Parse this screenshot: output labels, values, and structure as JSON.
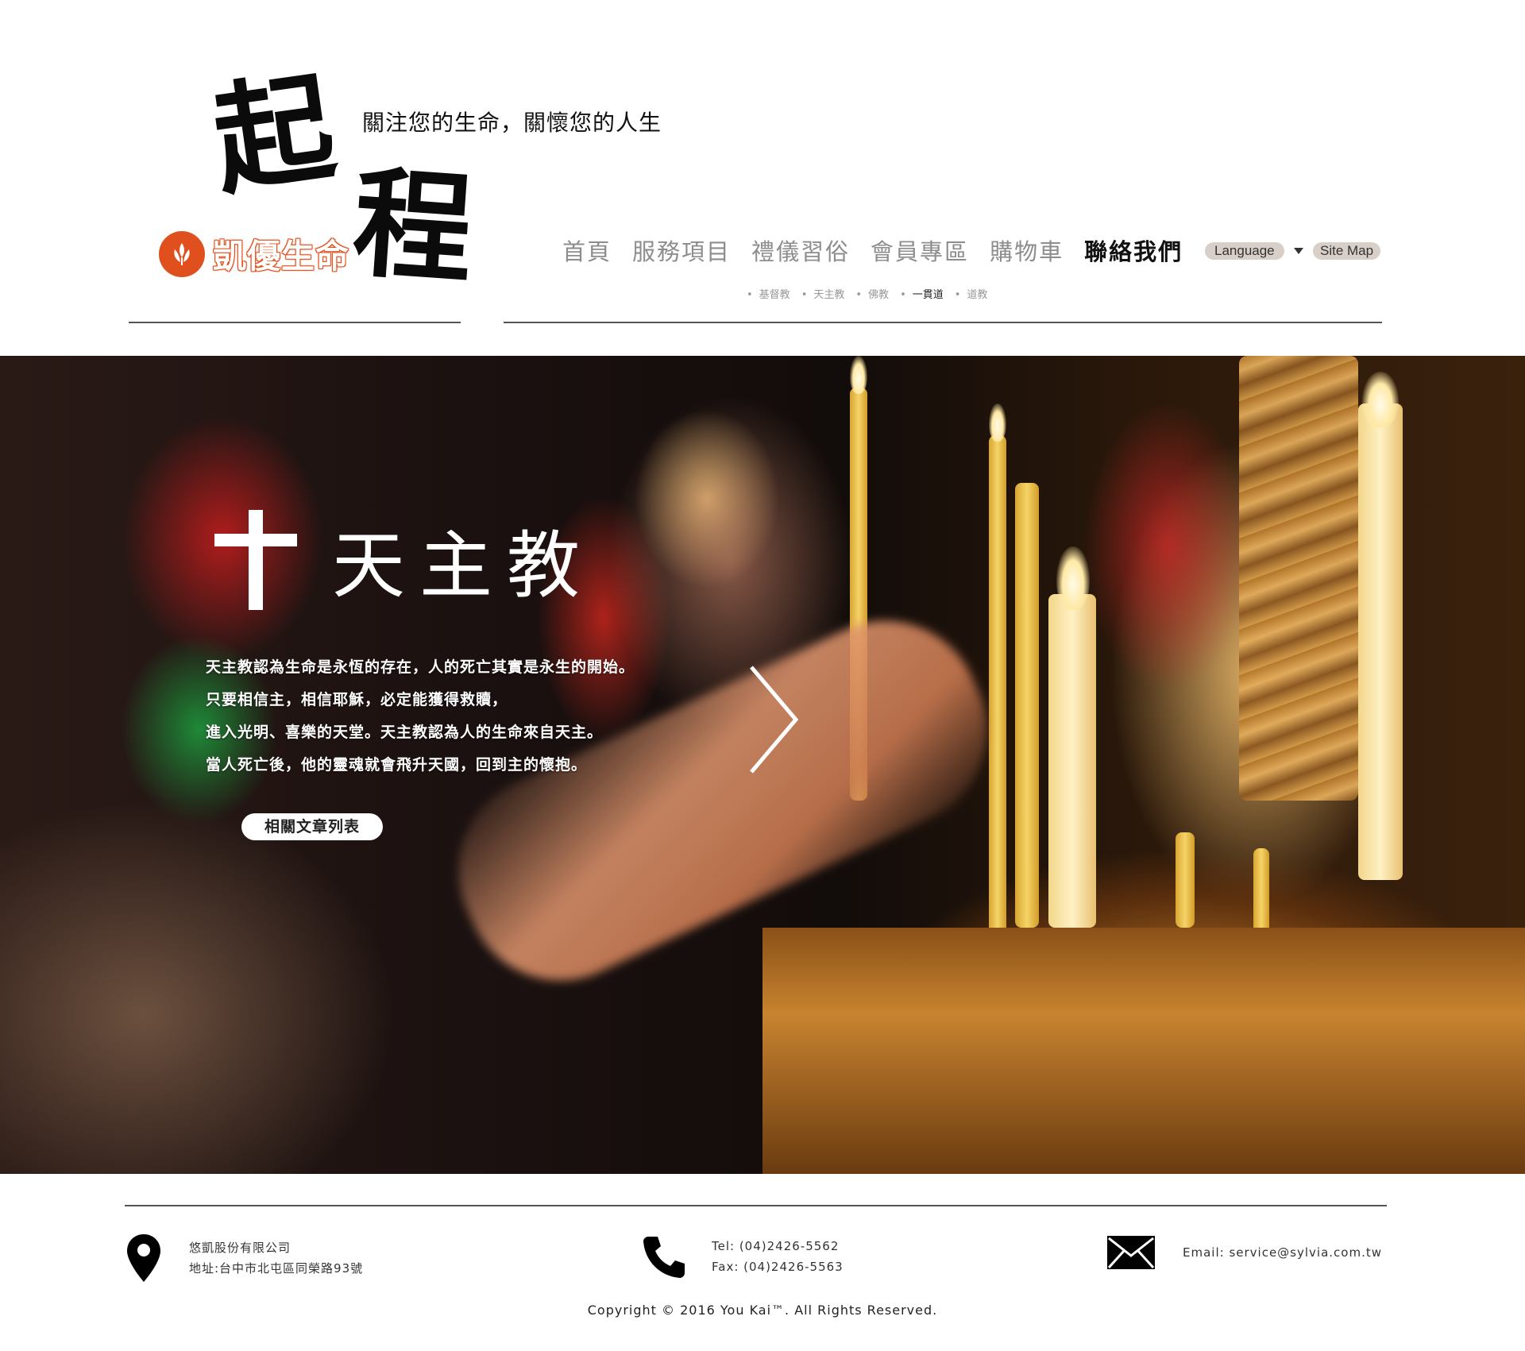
{
  "header": {
    "logo_calligraphy": [
      "起",
      "程"
    ],
    "tagline": "關注您的生命，關懷您的人生",
    "brand_name": "凱優生命",
    "nav": [
      {
        "label": "首頁",
        "active": false
      },
      {
        "label": "服務項目",
        "active": false
      },
      {
        "label": "禮儀習俗",
        "active": false
      },
      {
        "label": "會員專區",
        "active": false
      },
      {
        "label": "購物車",
        "active": false
      },
      {
        "label": "聯絡我們",
        "active": true
      }
    ],
    "language_label": "Language",
    "sitemap_label": "Site Map",
    "subnav": [
      {
        "label": "基督教",
        "active": false
      },
      {
        "label": "天主教",
        "active": false
      },
      {
        "label": "佛教",
        "active": false
      },
      {
        "label": "一貫道",
        "active": true
      },
      {
        "label": "道教",
        "active": false
      }
    ]
  },
  "hero": {
    "title": "天主教",
    "lines": [
      "天主教認為生命是永恆的存在，人的死亡其實是永生的開始。",
      "只要相信主，相信耶穌，必定能獲得救贖，",
      "進入光明、喜樂的天堂。天主教認為人的生命來自天主。",
      "當人死亡後，他的靈魂就會飛升天國，回到主的懷抱。"
    ],
    "button_label": "相關文章列表"
  },
  "footer": {
    "company": "悠凱股份有限公司",
    "address": "地址:台中市北屯區同榮路93號",
    "tel": "Tel: (04)2426-5562",
    "fax": "Fax: (04)2426-5563",
    "email": "Email: service@sylvia.com.tw",
    "copyright": "Copyright © 2016 You Kai™. All Rights Reserved."
  },
  "icons": {
    "brand": "flame-lotus-icon",
    "location": "map-pin-icon",
    "phone": "phone-icon",
    "mail": "envelope-icon",
    "next": "chevron-right-icon",
    "cross": "cross-icon"
  },
  "colors": {
    "brand_orange": "#e0501e",
    "nav_inactive": "#8d8d8d",
    "nav_active": "#111111",
    "pill_bg": "#d7cfc8"
  }
}
